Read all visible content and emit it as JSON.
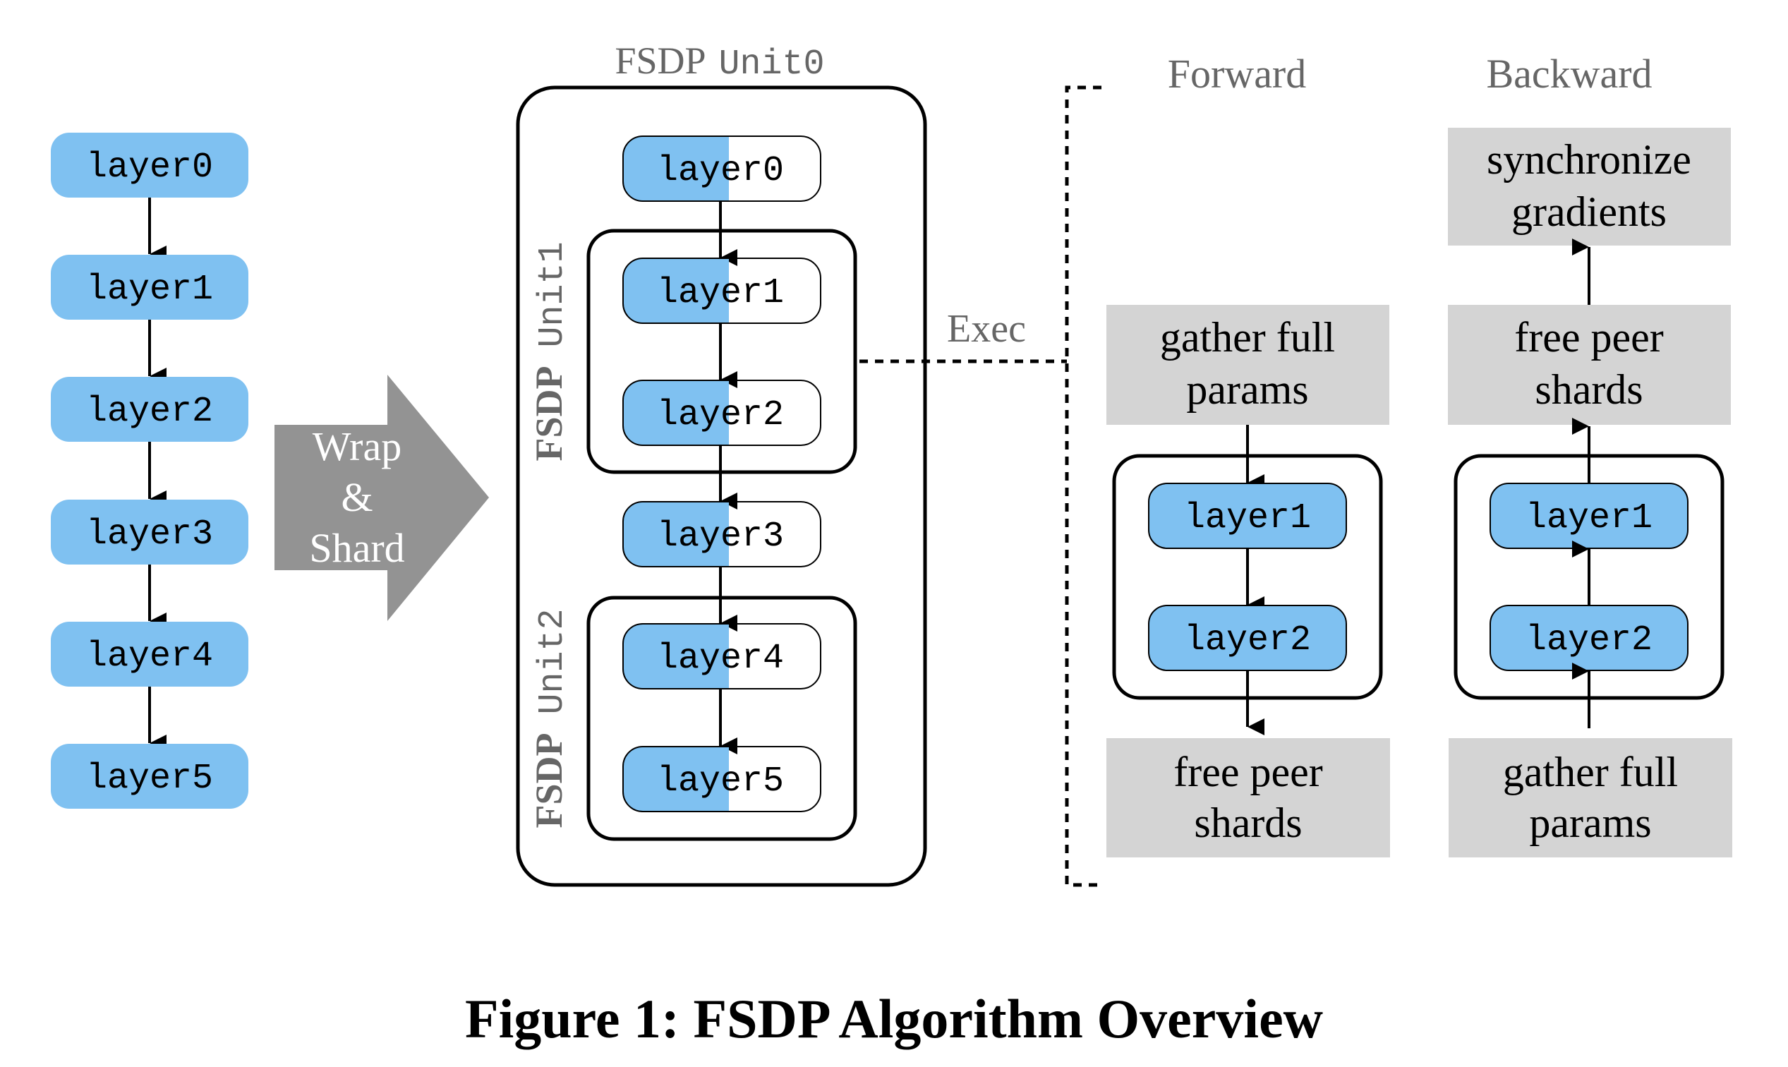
{
  "colors": {
    "layer_blue": "#7fc1f1",
    "step_gray": "#d4d4d4",
    "arrow_gray": "#939393",
    "label_gray": "#666666",
    "stroke": "#000000"
  },
  "original_model": {
    "layers": [
      "layer0",
      "layer1",
      "layer2",
      "layer3",
      "layer4",
      "layer5"
    ]
  },
  "wrap_arrow": {
    "lines": [
      "Wrap",
      "&",
      "Shard"
    ]
  },
  "fsdp_unit0": {
    "title_bold": "FSDP",
    "title_mono": "Unit0",
    "layers": [
      "layer0",
      "layer1",
      "layer2",
      "layer3",
      "layer4",
      "layer5"
    ],
    "sub_units": [
      {
        "label_bold": "FSDP",
        "label_mono": "Unit1",
        "layers": [
          "layer1",
          "layer2"
        ]
      },
      {
        "label_bold": "FSDP",
        "label_mono": "Unit2",
        "layers": [
          "layer4",
          "layer5"
        ]
      }
    ]
  },
  "exec_label": "Exec",
  "forward": {
    "title": "Forward",
    "pre_step": [
      "gather full",
      "params"
    ],
    "layers": [
      "layer1",
      "layer2"
    ],
    "post_step": [
      "free peer",
      "shards"
    ]
  },
  "backward": {
    "title": "Backward",
    "pre_step": [
      "gather full",
      "params"
    ],
    "layers": [
      "layer2",
      "layer1"
    ],
    "mid_step": [
      "free peer",
      "shards"
    ],
    "post_step": [
      "synchronize",
      "gradients"
    ]
  },
  "caption": "Figure 1: FSDP Algorithm Overview"
}
